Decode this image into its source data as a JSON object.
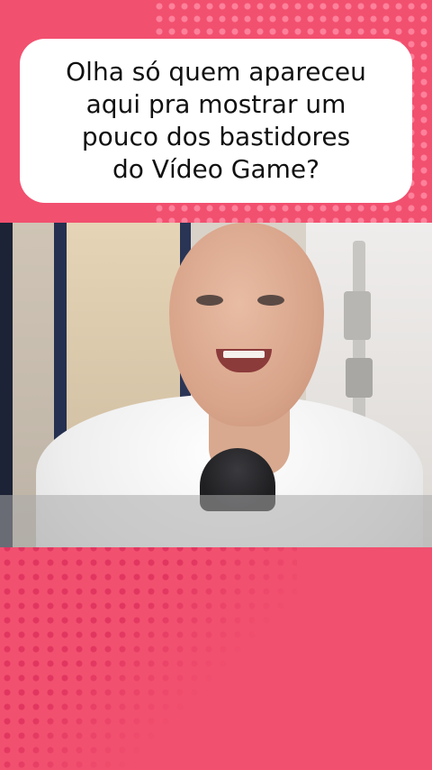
{
  "caption": {
    "text": "Olha só quem apareceu\naqui pra mostrar um\npouco dos bastidores\ndo Vídeo Game?"
  },
  "video": {
    "description_label": ""
  },
  "colors": {
    "background": "#f2506f",
    "dots_light": "#ff8aa3",
    "dots_dark": "#e13660",
    "caption_box": "#ffffff",
    "caption_text": "#111111"
  }
}
